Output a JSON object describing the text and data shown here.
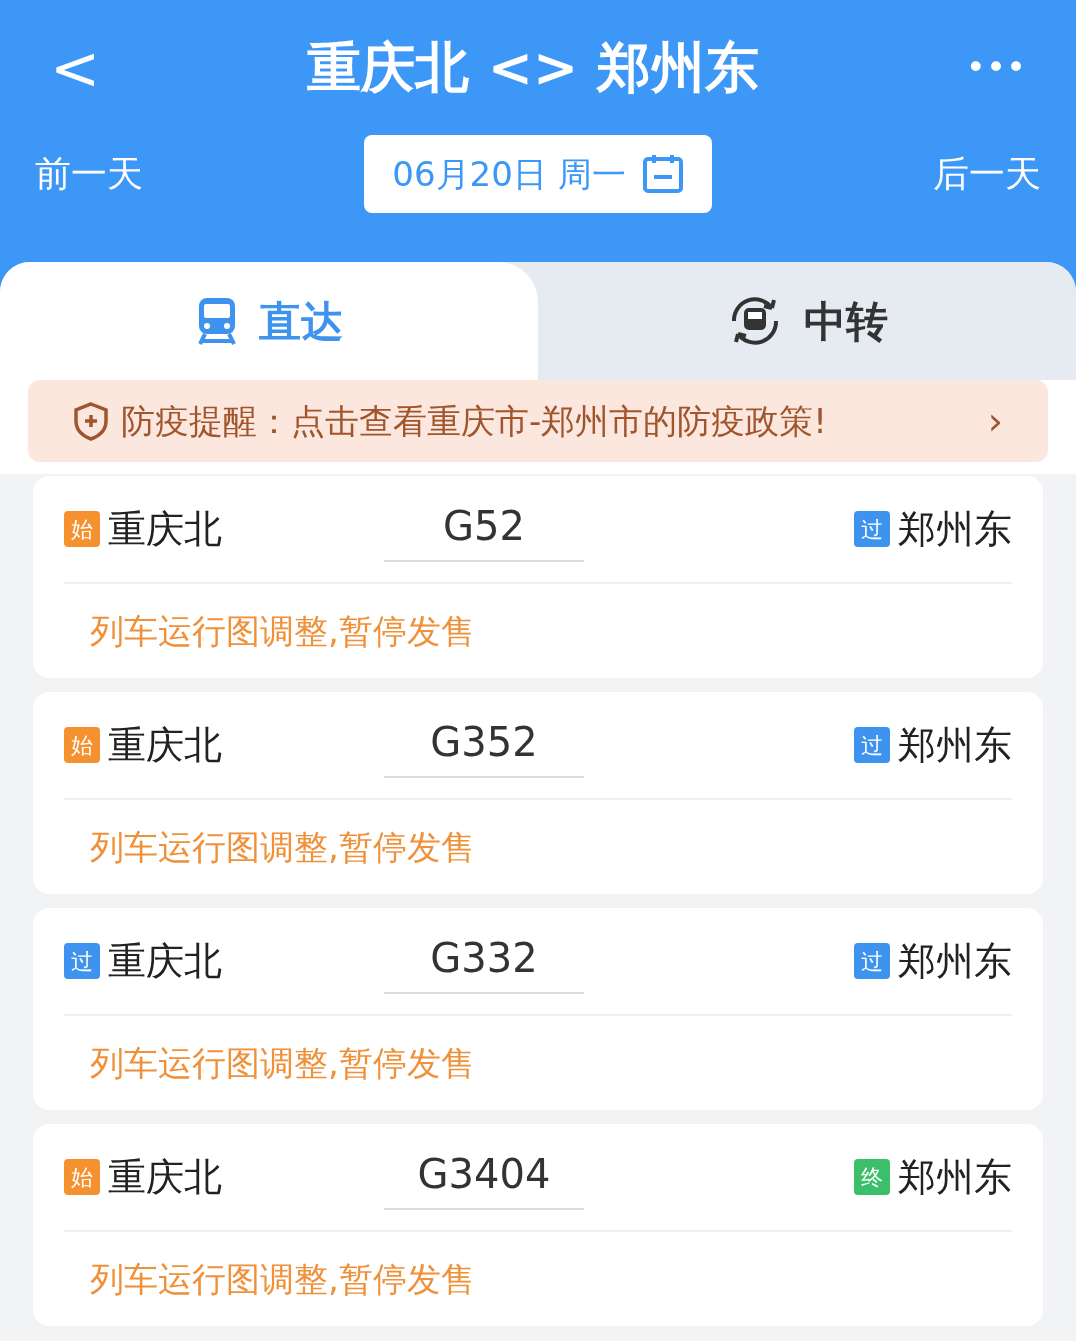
{
  "header": {
    "back": "<",
    "title": "重庆北 <> 郑州东",
    "more": "•••"
  },
  "date_bar": {
    "prev": "前一天",
    "date": "06月20日 周一",
    "next": "后一天"
  },
  "tabs": [
    {
      "label": "直达",
      "selected": true,
      "kind": "train"
    },
    {
      "label": "中转",
      "selected": false,
      "kind": "transfer"
    }
  ],
  "notice": {
    "text": "防疫提醒：点击查看重庆市-郑州市的防疫政策!",
    "arrow": "›"
  },
  "trains": [
    {
      "from_badge": {
        "text": "始",
        "color": "#f5922f"
      },
      "from": "重庆北",
      "number": "G52",
      "to_badge": {
        "text": "过",
        "color": "#3d93ee"
      },
      "to": "郑州东",
      "status": "列车运行图调整,暂停发售"
    },
    {
      "from_badge": {
        "text": "始",
        "color": "#f5922f"
      },
      "from": "重庆北",
      "number": "G352",
      "to_badge": {
        "text": "过",
        "color": "#3d93ee"
      },
      "to": "郑州东",
      "status": "列车运行图调整,暂停发售"
    },
    {
      "from_badge": {
        "text": "过",
        "color": "#3d93ee"
      },
      "from": "重庆北",
      "number": "G332",
      "to_badge": {
        "text": "过",
        "color": "#3d93ee"
      },
      "to": "郑州东",
      "status": "列车运行图调整,暂停发售"
    },
    {
      "from_badge": {
        "text": "始",
        "color": "#f5922f"
      },
      "from": "重庆北",
      "number": "G3404",
      "to_badge": {
        "text": "终",
        "color": "#3cbf6a"
      },
      "to": "郑州东",
      "status": "列车运行图调整,暂停发售"
    }
  ]
}
